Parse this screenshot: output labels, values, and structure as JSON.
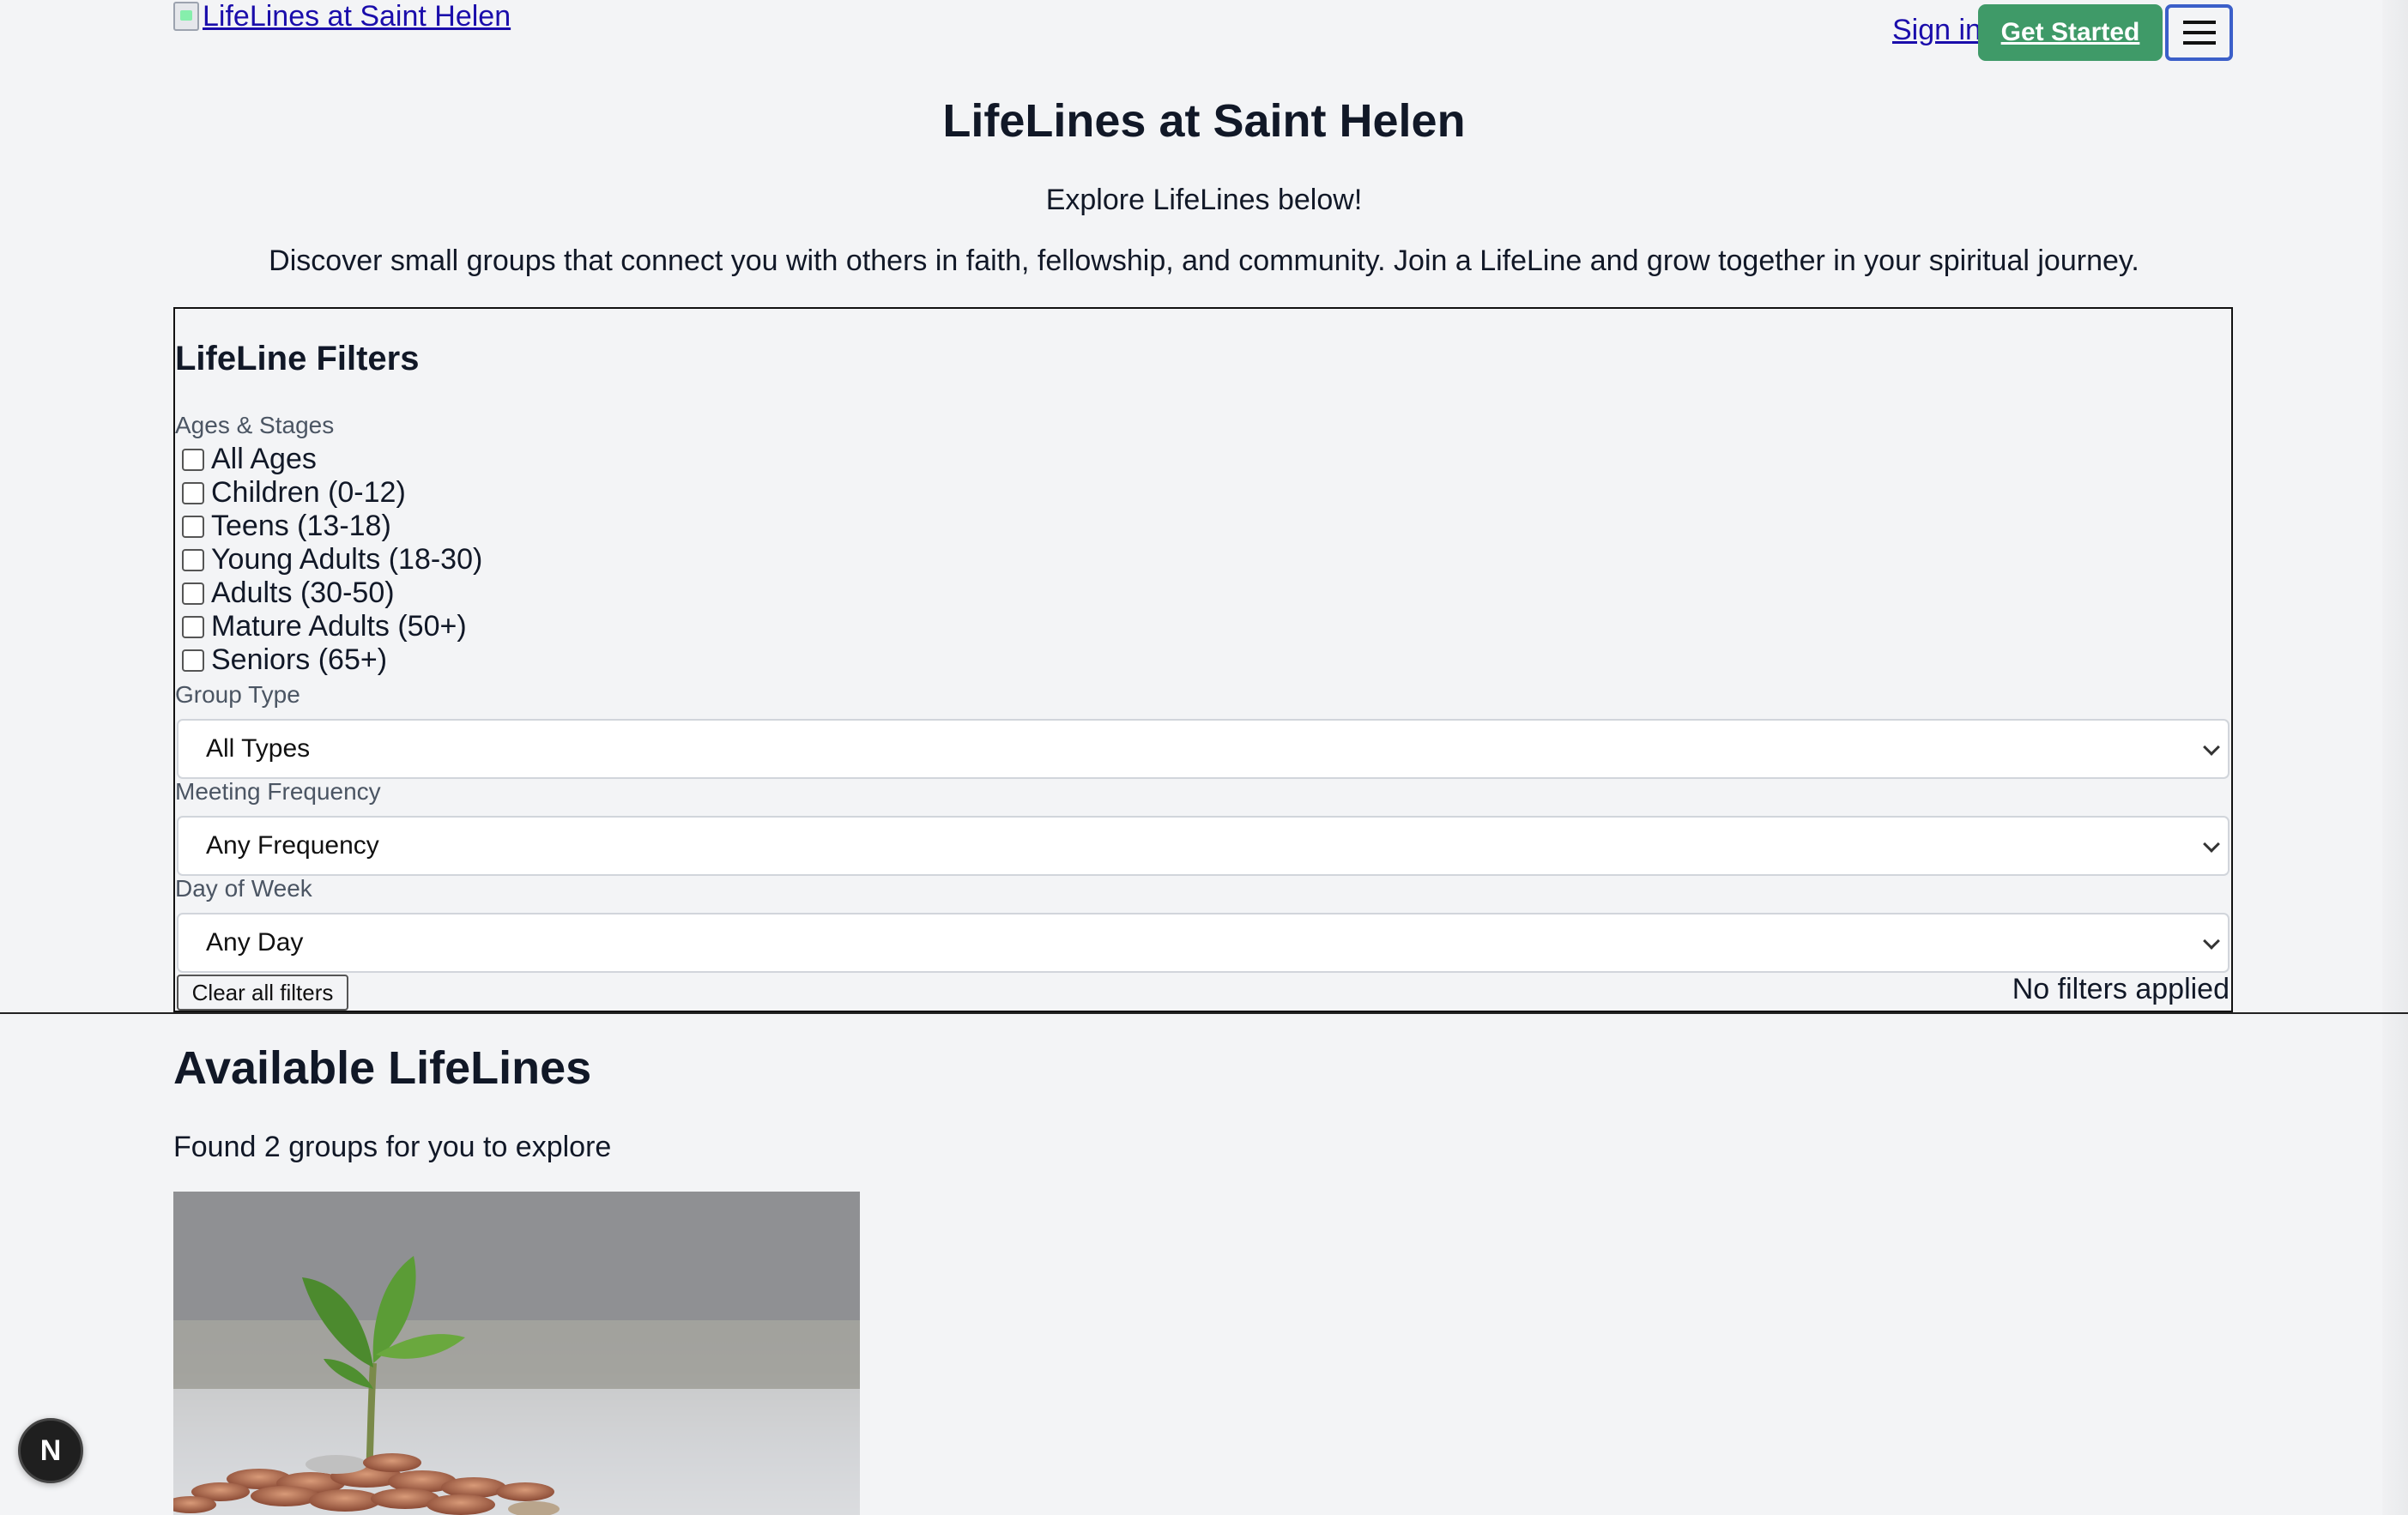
{
  "header": {
    "logo_alt": "LifeLines at Saint Helen",
    "signin_label": "Sign in",
    "get_started_label": "Get Started"
  },
  "hero": {
    "title": "LifeLines at Saint Helen",
    "subtitle": "Explore LifeLines below!",
    "description": "Discover small groups that connect you with others in faith, fellowship, and community. Join a LifeLine and grow together in your spiritual journey."
  },
  "filters": {
    "title": "LifeLine Filters",
    "ages_label": "Ages & Stages",
    "ages": [
      "All Ages",
      "Children (0-12)",
      "Teens (13-18)",
      "Young Adults (18-30)",
      "Adults (30-50)",
      "Mature Adults (50+)",
      "Seniors (65+)"
    ],
    "group_type_label": "Group Type",
    "group_type_value": "All Types",
    "frequency_label": "Meeting Frequency",
    "frequency_value": "Any Frequency",
    "day_label": "Day of Week",
    "day_value": "Any Day",
    "clear_label": "Clear all filters",
    "status": "No filters applied"
  },
  "results": {
    "title": "Available LifeLines",
    "count_text": "Found 2 groups for you to explore"
  },
  "dev_badge": "N",
  "icons": {
    "menu": "hamburger-menu-icon",
    "chevron": "chevron-down-icon",
    "broken_image": "broken-image-icon"
  },
  "colors": {
    "accent_green": "#3f9a68",
    "link": "#1a0dab",
    "menu_border": "#3b5fc9"
  }
}
